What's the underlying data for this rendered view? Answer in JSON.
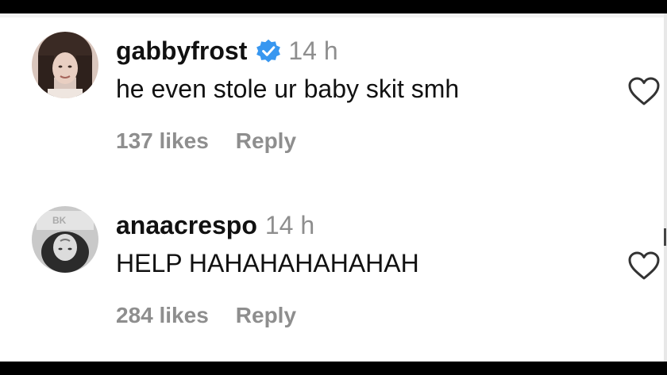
{
  "comments": [
    {
      "username": "gabbyfrost",
      "verified": true,
      "time": "14 h",
      "text": "he even stole ur baby skit smh",
      "likes": "137 likes",
      "reply_label": "Reply"
    },
    {
      "username": "anaacrespo",
      "verified": false,
      "time": "14 h",
      "text": "HELP HAHAHAHAHAHAH",
      "likes": "284 likes",
      "reply_label": "Reply"
    }
  ],
  "colors": {
    "verified_badge": "#3897f0",
    "secondary_text": "#8e8e8e",
    "primary_text": "#111111"
  },
  "icons": [
    "verified-badge-icon",
    "heart-outline-icon"
  ]
}
